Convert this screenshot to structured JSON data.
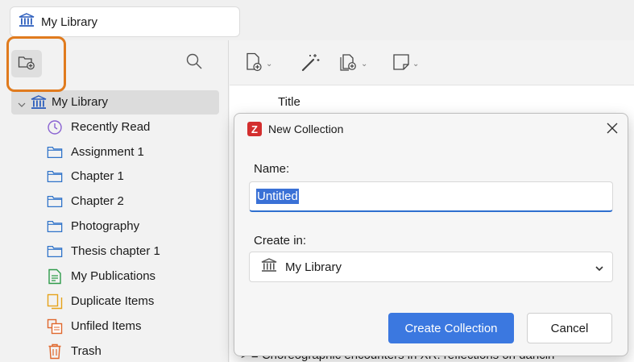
{
  "tab": {
    "label": "My Library",
    "icon": "library-icon"
  },
  "left_toolbar": {
    "new_collection_icon": "new-collection-icon",
    "search_icon": "search-icon"
  },
  "tree": [
    {
      "label": "My Library",
      "icon": "library-icon",
      "selected": true
    },
    {
      "label": "Recently Read",
      "icon": "clock-icon"
    },
    {
      "label": "Assignment 1",
      "icon": "folder-icon"
    },
    {
      "label": "Chapter 1",
      "icon": "folder-icon"
    },
    {
      "label": "Chapter 2",
      "icon": "folder-icon"
    },
    {
      "label": "Photography",
      "icon": "folder-icon"
    },
    {
      "label": "Thesis chapter 1",
      "icon": "folder-icon"
    },
    {
      "label": "My Publications",
      "icon": "publications-icon"
    },
    {
      "label": "Duplicate Items",
      "icon": "duplicate-icon"
    },
    {
      "label": "Unfiled Items",
      "icon": "unfiled-icon"
    },
    {
      "label": "Trash",
      "icon": "trash-icon"
    }
  ],
  "right_toolbar": {
    "new_item_icon": "new-item-icon",
    "magic_wand_icon": "magic-wand-icon",
    "add_attachment_icon": "add-attachment-icon",
    "new_note_icon": "new-note-icon"
  },
  "items_table": {
    "column_title": "Title",
    "partial_row_text": "> ≡ Choreographic encounters in XR: reflections on dancin"
  },
  "dialog": {
    "title": "New Collection",
    "name_label": "Name:",
    "name_value": "Untitled",
    "create_in_label": "Create in:",
    "create_in_value": "My Library",
    "create_button": "Create Collection",
    "cancel_button": "Cancel"
  },
  "colors": {
    "accent": "#3b78e0",
    "highlight_ring": "#e07b1e",
    "library_icon": "#2e5fbd",
    "folder_icon": "#2f73c9",
    "zotero_red": "#d32f2f"
  }
}
